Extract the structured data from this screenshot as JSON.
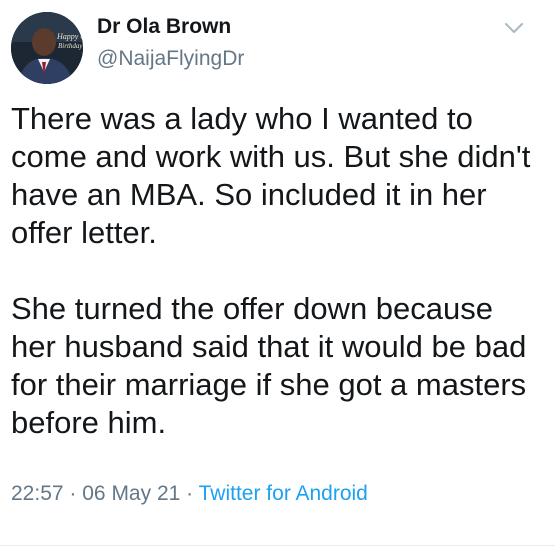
{
  "author": {
    "name": "Dr Ola Brown",
    "handle": "@NaijaFlyingDr",
    "avatar_icon": "profile-photo",
    "avatar_overlay_line1": "Happy 64",
    "avatar_overlay_line2": "Birthday"
  },
  "menu": {
    "icon": "chevron-down-icon"
  },
  "tweet": {
    "paragraphs": [
      "There was a lady who I wanted to come and work with us. But she didn't have an MBA. So included it in her offer letter.",
      "She turned the offer down because her husband said that it would be bad for their marriage if she got a masters before him."
    ],
    "time": "22:57",
    "separator": "·",
    "date": "06 May 21",
    "source": "Twitter for Android"
  },
  "colors": {
    "text": "#14171a",
    "muted": "#657786",
    "link": "#1da1f2",
    "caret": "#aab8c2"
  }
}
